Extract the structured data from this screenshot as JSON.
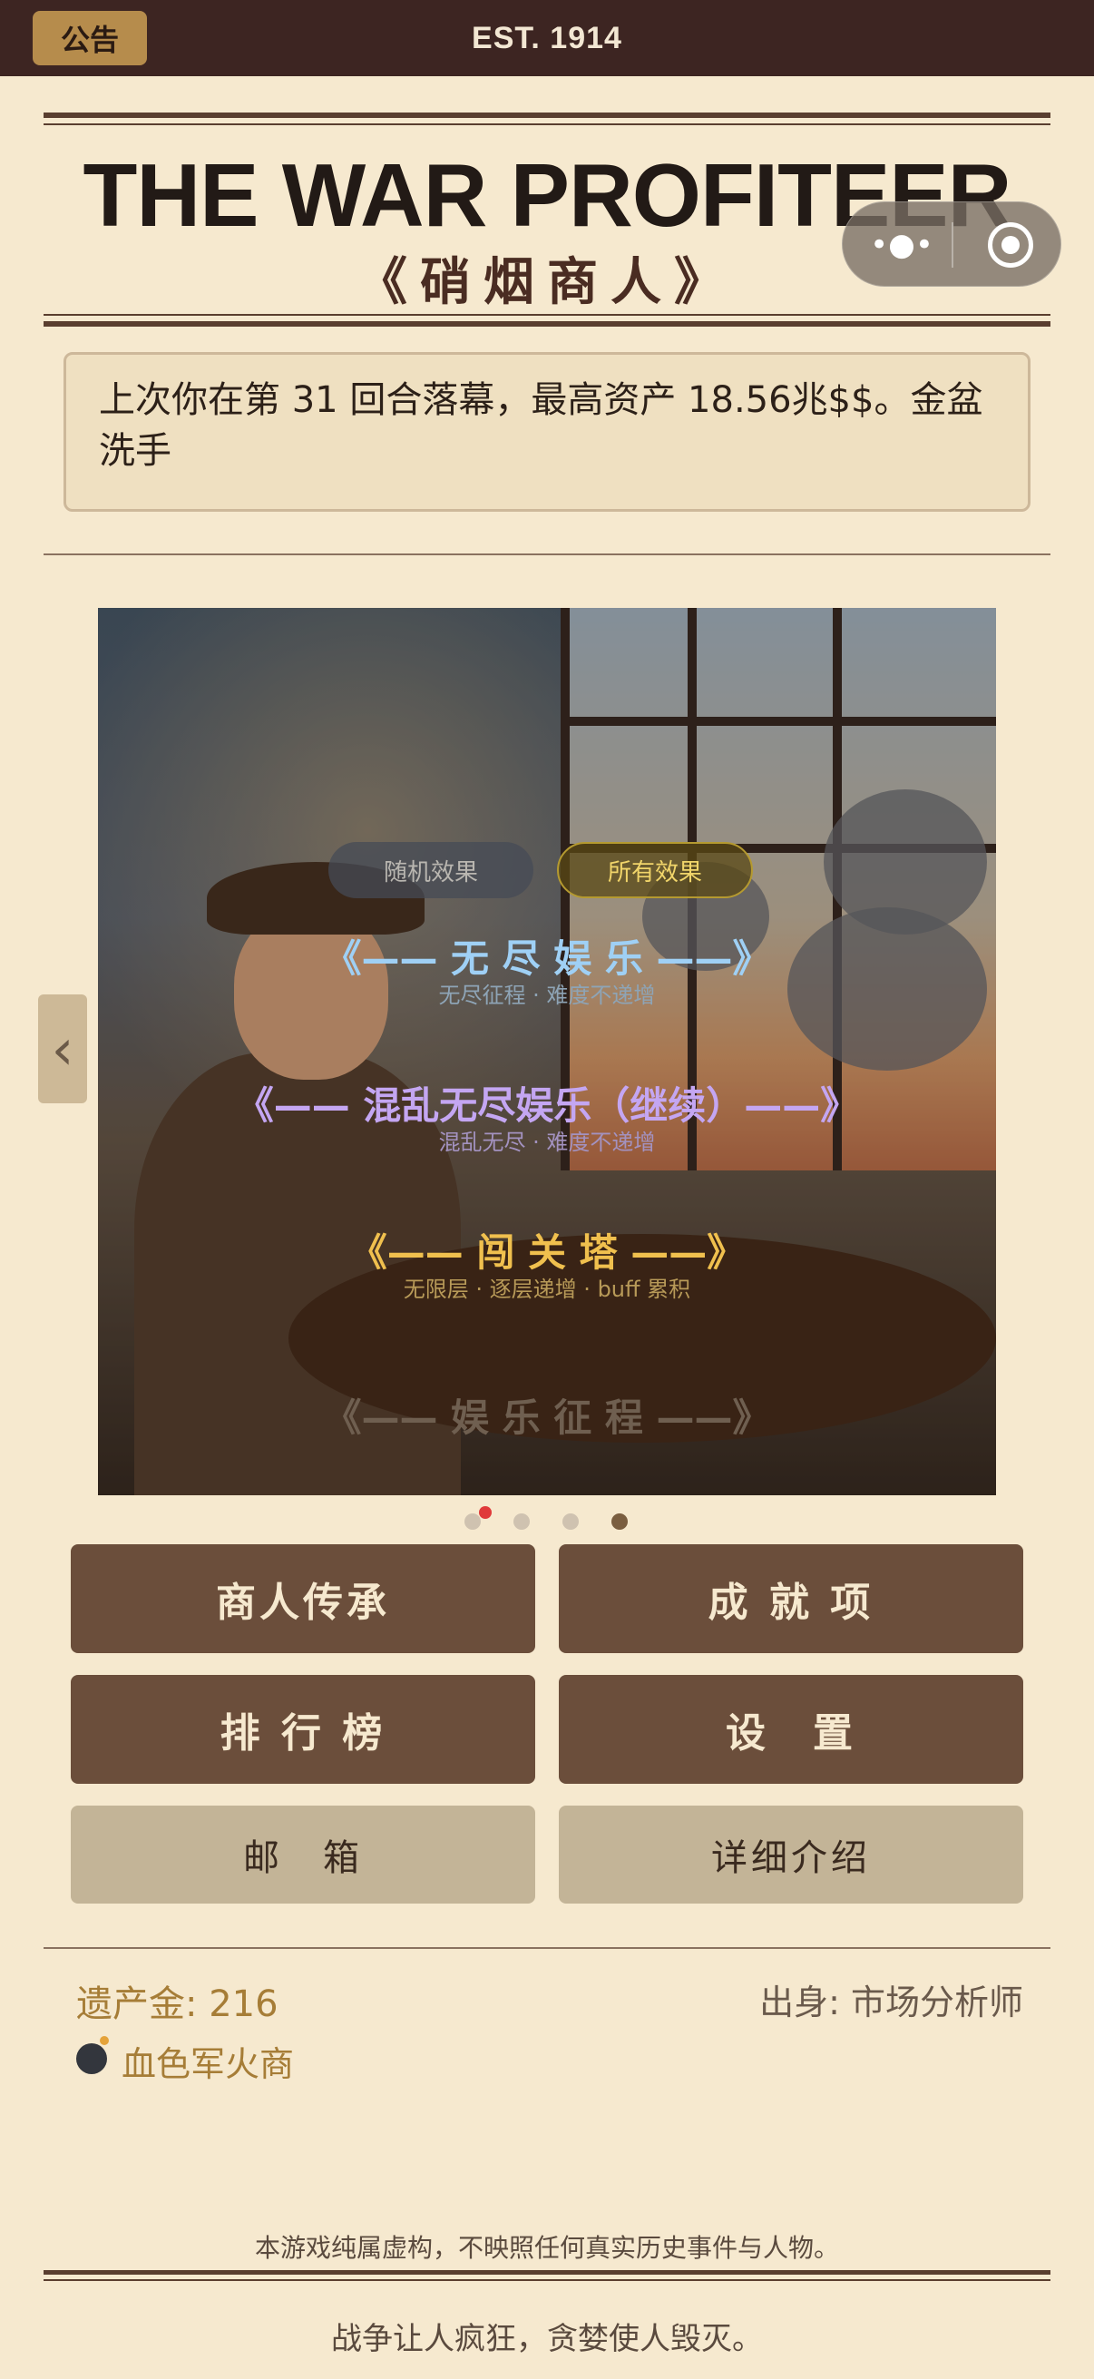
{
  "top_bar": {
    "notice_label": "公告",
    "est_label": "EST. 1914"
  },
  "header": {
    "title": "THE WAR PROFITEER",
    "subtitle": "《硝烟商人》"
  },
  "mini_program_capsule": {
    "more_icon": "more-dots-icon",
    "close_icon": "target-close-icon"
  },
  "last_game_message": "上次你在第 31 回合落幕，最高资产 18.56兆$$。金盆洗手",
  "banner": {
    "effect_tabs": [
      {
        "label": "随机效果",
        "selected": false
      },
      {
        "label": "所有效果",
        "selected": true
      }
    ],
    "modes": [
      {
        "title": "《—— 无 尽 娱 乐 ——》",
        "subtitle": "无尽征程 · 难度不递增",
        "color": "#9fd0f5"
      },
      {
        "title": "《—— 混乱无尽娱乐（继续）——》",
        "subtitle": "混乱无尽 · 难度不递增",
        "color": "#c4a6f2"
      },
      {
        "title": "《—— 闯 关 塔 ——》",
        "subtitle": "无限层 · 逐层递增 · buff 累积",
        "color": "#f0c04e"
      },
      {
        "title": "《—— 娱 乐 征 程 ——》",
        "subtitle": "",
        "color": "#6f5f50"
      }
    ],
    "carousel_dots": 4,
    "carousel_active_index": 0
  },
  "nav": {
    "prev_icon": "chevron-left-icon"
  },
  "menu": {
    "heritage": "商人传承",
    "achievements": "成 就 项",
    "leaderboard": "排 行 榜",
    "settings": "设　置",
    "mailbox": "邮　箱",
    "details": "详细介绍"
  },
  "stats": {
    "legacy_gold": "遗产金: 216",
    "origin": "出身: 市场分析师",
    "title": "血色军火商"
  },
  "footer": {
    "disclaimer": "本游戏纯属虚构，不映照任何真实历史事件与人物。",
    "motto": "战争让人疯狂，贪婪使人毁灭。"
  },
  "colors": {
    "background": "#f6e9cf",
    "top_bar": "#3d2522",
    "notice_button": "#b68c4c",
    "primary_button": "#6b4e3b",
    "secondary_button": "#c3b497",
    "gold_text": "#a67d37",
    "active_dot": "#e03a3a"
  }
}
